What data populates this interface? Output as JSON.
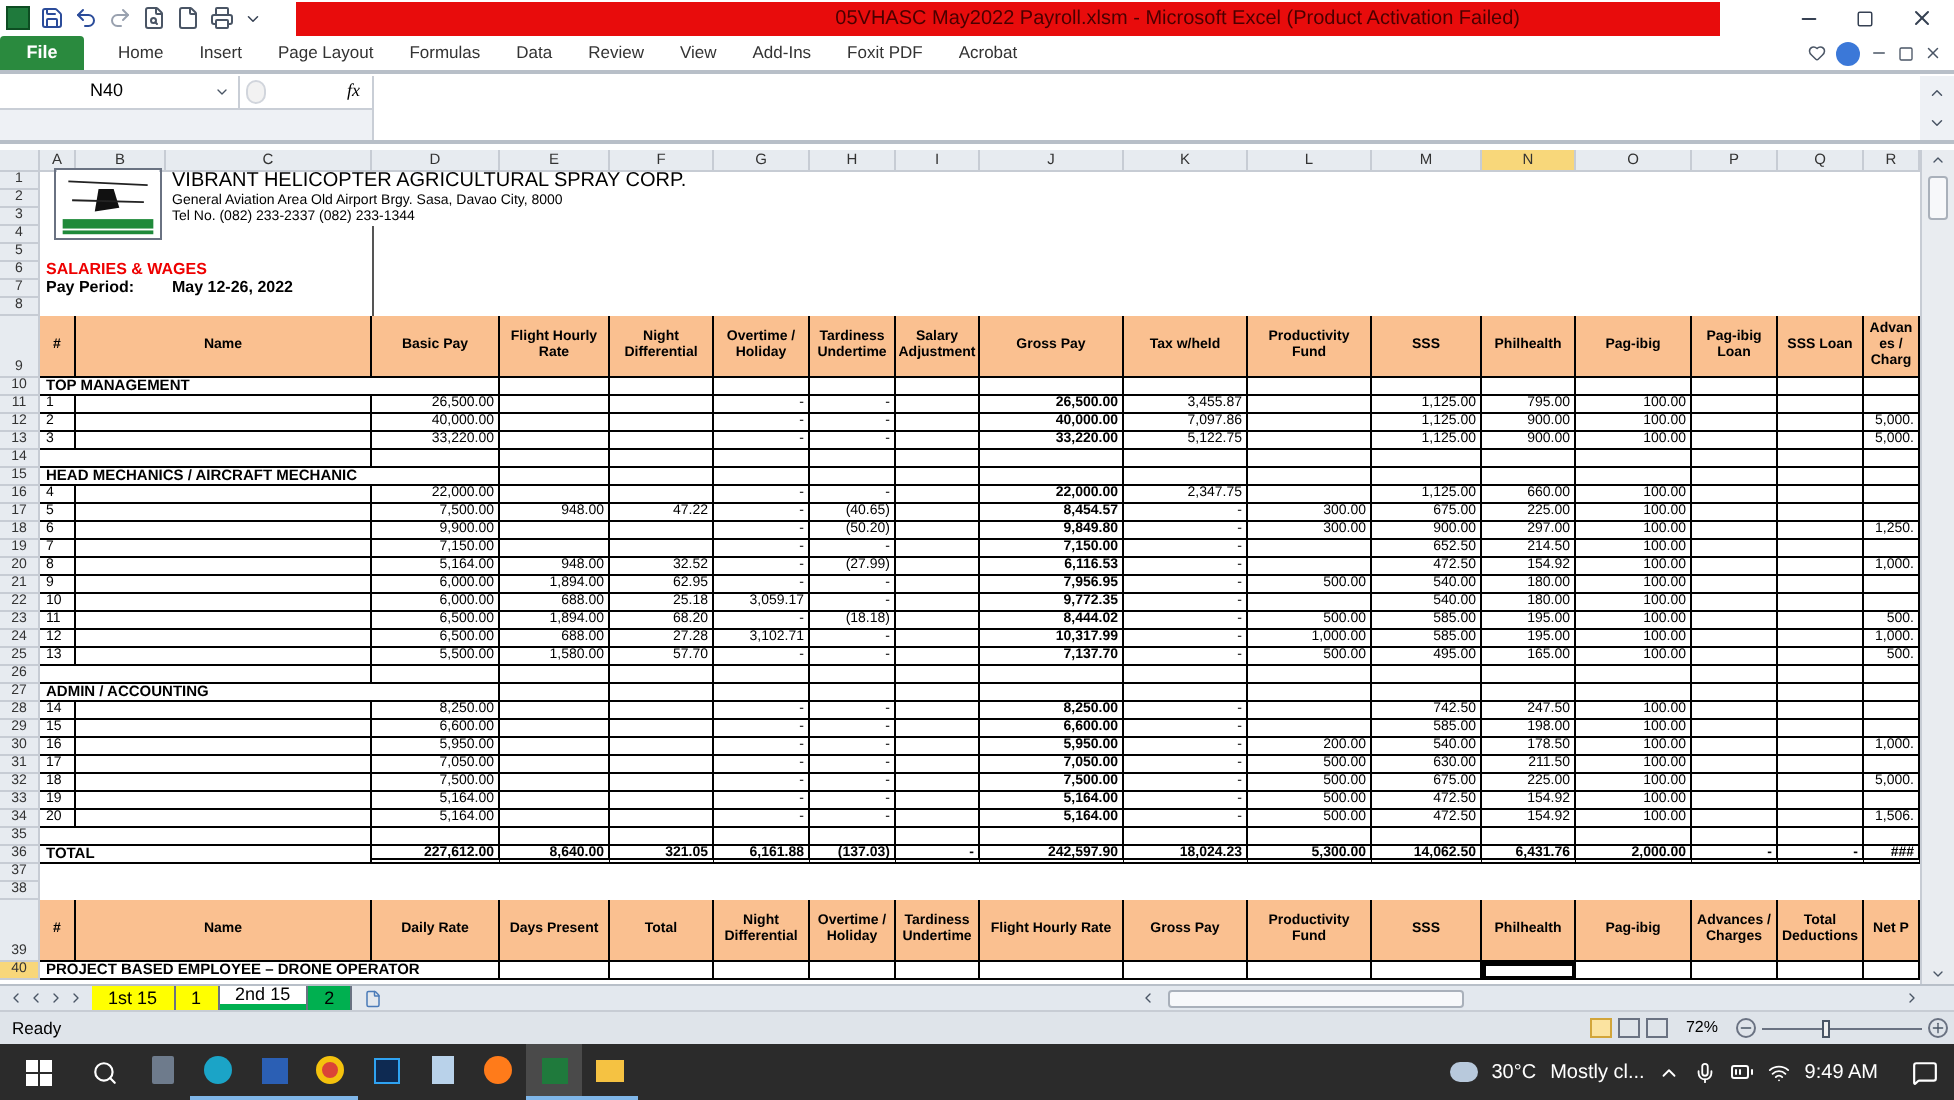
{
  "title_bar": {
    "title": "05VHASC May2022 Payroll.xlsm  -  Microsoft Excel (Product Activation Failed)"
  },
  "ribbon_tabs": [
    {
      "label": "File",
      "kind": "file"
    },
    {
      "label": "Home",
      "kind": "tab"
    },
    {
      "label": "Insert",
      "kind": "tab"
    },
    {
      "label": "Page Layout",
      "kind": "tab"
    },
    {
      "label": "Formulas",
      "kind": "tab"
    },
    {
      "label": "Data",
      "kind": "tab"
    },
    {
      "label": "Review",
      "kind": "tab"
    },
    {
      "label": "View",
      "kind": "tab"
    },
    {
      "label": "Add-Ins",
      "kind": "tab"
    },
    {
      "label": "Foxit PDF",
      "kind": "tab"
    },
    {
      "label": "Acrobat",
      "kind": "tab"
    }
  ],
  "name_box": "N40",
  "formula_label": "fx",
  "columns": [
    {
      "label": "A",
      "selected": false
    },
    {
      "label": "B",
      "selected": false
    },
    {
      "label": "C",
      "selected": false
    },
    {
      "label": "D",
      "selected": false
    },
    {
      "label": "E",
      "selected": false
    },
    {
      "label": "F",
      "selected": false
    },
    {
      "label": "G",
      "selected": false
    },
    {
      "label": "H",
      "selected": false
    },
    {
      "label": "I",
      "selected": false
    },
    {
      "label": "J",
      "selected": false
    },
    {
      "label": "K",
      "selected": false
    },
    {
      "label": "L",
      "selected": false
    },
    {
      "label": "M",
      "selected": false
    },
    {
      "label": "N",
      "selected": true
    },
    {
      "label": "O",
      "selected": false
    },
    {
      "label": "P",
      "selected": false
    },
    {
      "label": "Q",
      "selected": false
    },
    {
      "label": "R",
      "selected": false
    }
  ],
  "top_rows": [
    "1",
    "2",
    "3",
    "4",
    "5",
    "6",
    "7",
    "8"
  ],
  "company": {
    "name": "VIBRANT HELICOPTER AGRICULTURAL SPRAY CORP.",
    "address": "General Aviation Area Old Airport Brgy. Sasa, Davao City, 8000",
    "phone": "Tel No. (082) 233-2337 (082) 233-1344"
  },
  "sheet_title": "SALARIES & WAGES",
  "pay_period": {
    "label": "Pay Period:",
    "value": "May 12-26, 2022"
  },
  "rows": [
    {
      "row": "9",
      "kind": "header",
      "selected": false,
      "labels": [
        "#",
        "Name",
        "Basic Pay",
        "Flight Hourly Rate",
        "Night Differential",
        "Overtime / Holiday",
        "Tardiness Undertime",
        "Salary Adjustment",
        "Gross Pay",
        "Tax w/held",
        "Productivity Fund",
        "SSS",
        "Philhealth",
        "Pag-ibig",
        "Pag-ibig Loan",
        "SSS Loan",
        "Advan es / Charg"
      ]
    },
    {
      "row": "10",
      "kind": "section",
      "selected": false,
      "label": "TOP MANAGEMENT"
    },
    {
      "row": "11",
      "kind": "data",
      "selected": false,
      "number": "1",
      "values": {
        "d": "26,500.00",
        "g": "-",
        "h": "-",
        "j": "26,500.00",
        "k": "3,455.87",
        "m": "1,125.00",
        "n": "795.00",
        "o": "100.00"
      }
    },
    {
      "row": "12",
      "kind": "data",
      "selected": false,
      "number": "2",
      "values": {
        "d": "40,000.00",
        "g": "-",
        "h": "-",
        "j": "40,000.00",
        "k": "7,097.86",
        "m": "1,125.00",
        "n": "900.00",
        "o": "100.00",
        "r": "5,000."
      }
    },
    {
      "row": "13",
      "kind": "data",
      "selected": false,
      "number": "3",
      "values": {
        "d": "33,220.00",
        "g": "-",
        "h": "-",
        "j": "33,220.00",
        "k": "5,122.75",
        "m": "1,125.00",
        "n": "900.00",
        "o": "100.00",
        "r": "5,000."
      }
    },
    {
      "row": "14",
      "kind": "blank",
      "selected": false
    },
    {
      "row": "15",
      "kind": "section",
      "selected": false,
      "label": "HEAD MECHANICS / AIRCRAFT MECHANIC"
    },
    {
      "row": "16",
      "kind": "data",
      "selected": false,
      "number": "4",
      "values": {
        "d": "22,000.00",
        "g": "-",
        "h": "-",
        "j": "22,000.00",
        "k": "2,347.75",
        "m": "1,125.00",
        "n": "660.00",
        "o": "100.00"
      }
    },
    {
      "row": "17",
      "kind": "data",
      "selected": false,
      "number": "5",
      "values": {
        "d": "7,500.00",
        "e": "948.00",
        "f": "47.22",
        "g": "-",
        "h": "(40.65)",
        "j": "8,454.57",
        "k": "-",
        "l": "300.00",
        "m": "675.00",
        "n": "225.00",
        "o": "100.00"
      }
    },
    {
      "row": "18",
      "kind": "data",
      "selected": false,
      "number": "6",
      "values": {
        "d": "9,900.00",
        "g": "-",
        "h": "(50.20)",
        "j": "9,849.80",
        "k": "-",
        "l": "300.00",
        "m": "900.00",
        "n": "297.00",
        "o": "100.00",
        "r": "1,250."
      }
    },
    {
      "row": "19",
      "kind": "data",
      "selected": false,
      "number": "7",
      "values": {
        "d": "7,150.00",
        "g": "-",
        "h": "-",
        "j": "7,150.00",
        "k": "-",
        "m": "652.50",
        "n": "214.50",
        "o": "100.00"
      }
    },
    {
      "row": "20",
      "kind": "data",
      "selected": false,
      "number": "8",
      "values": {
        "d": "5,164.00",
        "e": "948.00",
        "f": "32.52",
        "g": "-",
        "h": "(27.99)",
        "j": "6,116.53",
        "k": "-",
        "m": "472.50",
        "n": "154.92",
        "o": "100.00",
        "r": "1,000."
      }
    },
    {
      "row": "21",
      "kind": "data",
      "selected": false,
      "number": "9",
      "values": {
        "d": "6,000.00",
        "e": "1,894.00",
        "f": "62.95",
        "g": "-",
        "h": "-",
        "j": "7,956.95",
        "k": "-",
        "l": "500.00",
        "m": "540.00",
        "n": "180.00",
        "o": "100.00"
      }
    },
    {
      "row": "22",
      "kind": "data",
      "selected": false,
      "number": "10",
      "values": {
        "d": "6,000.00",
        "e": "688.00",
        "f": "25.18",
        "g": "3,059.17",
        "h": "-",
        "j": "9,772.35",
        "k": "-",
        "m": "540.00",
        "n": "180.00",
        "o": "100.00"
      }
    },
    {
      "row": "23",
      "kind": "data",
      "selected": false,
      "number": "11",
      "values": {
        "d": "6,500.00",
        "e": "1,894.00",
        "f": "68.20",
        "g": "-",
        "h": "(18.18)",
        "j": "8,444.02",
        "k": "-",
        "l": "500.00",
        "m": "585.00",
        "n": "195.00",
        "o": "100.00",
        "r": "500."
      }
    },
    {
      "row": "24",
      "kind": "data",
      "selected": false,
      "number": "12",
      "values": {
        "d": "6,500.00",
        "e": "688.00",
        "f": "27.28",
        "g": "3,102.71",
        "h": "-",
        "j": "10,317.99",
        "k": "-",
        "l": "1,000.00",
        "m": "585.00",
        "n": "195.00",
        "o": "100.00",
        "r": "1,000."
      }
    },
    {
      "row": "25",
      "kind": "data",
      "selected": false,
      "number": "13",
      "values": {
        "d": "5,500.00",
        "e": "1,580.00",
        "f": "57.70",
        "g": "-",
        "h": "-",
        "j": "7,137.70",
        "k": "-",
        "l": "500.00",
        "m": "495.00",
        "n": "165.00",
        "o": "100.00",
        "r": "500."
      }
    },
    {
      "row": "26",
      "kind": "blank",
      "selected": false
    },
    {
      "row": "27",
      "kind": "section",
      "selected": false,
      "label": "ADMIN / ACCOUNTING"
    },
    {
      "row": "28",
      "kind": "data",
      "selected": false,
      "number": "14",
      "values": {
        "d": "8,250.00",
        "g": "-",
        "h": "-",
        "j": "8,250.00",
        "k": "-",
        "m": "742.50",
        "n": "247.50",
        "o": "100.00"
      }
    },
    {
      "row": "29",
      "kind": "data",
      "selected": false,
      "number": "15",
      "values": {
        "d": "6,600.00",
        "g": "-",
        "h": "-",
        "j": "6,600.00",
        "k": "-",
        "m": "585.00",
        "n": "198.00",
        "o": "100.00"
      }
    },
    {
      "row": "30",
      "kind": "data",
      "selected": false,
      "number": "16",
      "values": {
        "d": "5,950.00",
        "g": "-",
        "h": "-",
        "j": "5,950.00",
        "k": "-",
        "l": "200.00",
        "m": "540.00",
        "n": "178.50",
        "o": "100.00",
        "r": "1,000."
      }
    },
    {
      "row": "31",
      "kind": "data",
      "selected": false,
      "number": "17",
      "values": {
        "d": "7,050.00",
        "g": "-",
        "h": "-",
        "j": "7,050.00",
        "k": "-",
        "l": "500.00",
        "m": "630.00",
        "n": "211.50",
        "o": "100.00"
      }
    },
    {
      "row": "32",
      "kind": "data",
      "selected": false,
      "number": "18",
      "values": {
        "d": "7,500.00",
        "g": "-",
        "h": "-",
        "j": "7,500.00",
        "k": "-",
        "l": "500.00",
        "m": "675.00",
        "n": "225.00",
        "o": "100.00",
        "r": "5,000."
      }
    },
    {
      "row": "33",
      "kind": "data",
      "selected": false,
      "number": "19",
      "values": {
        "d": "5,164.00",
        "g": "-",
        "h": "-",
        "j": "5,164.00",
        "k": "-",
        "l": "500.00",
        "m": "472.50",
        "n": "154.92",
        "o": "100.00"
      }
    },
    {
      "row": "34",
      "kind": "data",
      "selected": false,
      "number": "20",
      "values": {
        "d": "5,164.00",
        "g": "-",
        "h": "-",
        "j": "5,164.00",
        "k": "-",
        "l": "500.00",
        "m": "472.50",
        "n": "154.92",
        "o": "100.00",
        "r": "1,506."
      }
    },
    {
      "row": "35",
      "kind": "blank",
      "selected": false
    },
    {
      "row": "36",
      "kind": "total",
      "selected": false,
      "label": "TOTAL",
      "values": {
        "d": "227,612.00",
        "e": "8,640.00",
        "f": "321.05",
        "g": "6,161.88",
        "h": "(137.03)",
        "i": "-",
        "j": "242,597.90",
        "k": "18,024.23",
        "l": "5,300.00",
        "m": "14,062.50",
        "n": "6,431.76",
        "o": "2,000.00",
        "p": "-",
        "q": "-",
        "r": "###"
      }
    },
    {
      "row": "37",
      "kind": "gap",
      "selected": false
    },
    {
      "row": "38",
      "kind": "gap",
      "selected": false
    },
    {
      "row": "39",
      "kind": "header",
      "selected": false,
      "labels": [
        "#",
        "Name",
        "Daily Rate",
        "Days Present",
        "Total",
        "Night Differential",
        "Overtime / Holiday",
        "Tardiness Undertime",
        "Flight Hourly Rate",
        "Gross Pay",
        "Productivity Fund",
        "SSS",
        "Philhealth",
        "Pag-ibig",
        "Advances / Charges",
        "Total Deductions",
        "Net P"
      ]
    },
    {
      "row": "40",
      "kind": "section",
      "selected": true,
      "label": "PROJECT BASED EMPLOYEE – DRONE OPERATOR"
    }
  ],
  "sheet_tabs": [
    {
      "label": "1st 15",
      "color": "#ffff00",
      "selected": false
    },
    {
      "label": "1",
      "color": "#ffff00",
      "selected": false
    },
    {
      "label": "2nd 15",
      "color": "#00b050",
      "selected": true
    },
    {
      "label": "2",
      "color": "#00b050",
      "selected": false
    }
  ],
  "status": "Ready",
  "zoom": {
    "label": "72%",
    "level": 0.4
  },
  "taskbar": {
    "apps": [
      {
        "open": false,
        "selected": false
      },
      {
        "open": true,
        "selected": false
      },
      {
        "open": true,
        "selected": false
      },
      {
        "open": true,
        "selected": false
      },
      {
        "open": false,
        "selected": false
      },
      {
        "open": false,
        "selected": false
      },
      {
        "open": false,
        "selected": false
      },
      {
        "open": true,
        "selected": true
      },
      {
        "open": true,
        "selected": false
      }
    ],
    "temperature": "30°C",
    "weather": "Mostly cl...",
    "time": "9:49 AM"
  }
}
